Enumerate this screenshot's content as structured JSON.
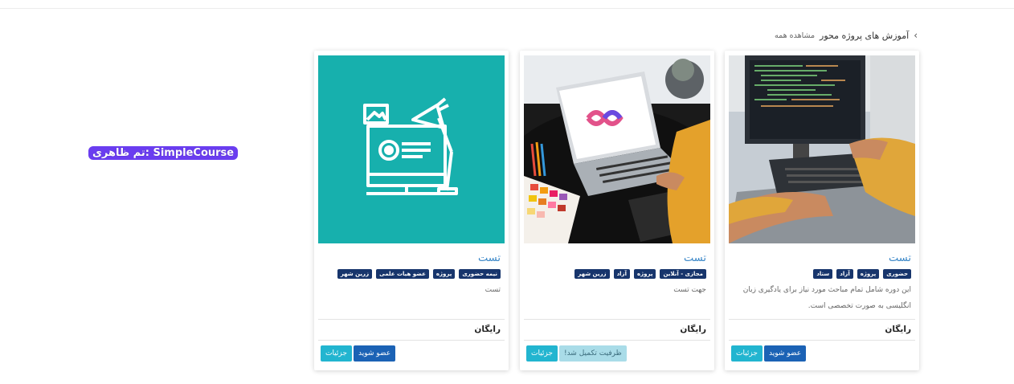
{
  "breadcrumb": {
    "title": "آموزش های پروژه محور",
    "subtitle": "مشاهده همه"
  },
  "theme_label": "SimpleCourse :تم ظاهری",
  "icons": {
    "breadcrumb": "chevron-right-icon"
  },
  "colors": {
    "title": "#3a87c8",
    "tag": "#17356c",
    "join_button": "#1b62b5",
    "details_button": "#22b5d0",
    "full_button": "#a9dce8",
    "placeholder_bg": "#17b0ad"
  },
  "cards": [
    {
      "title": "تست",
      "tags": [
        "حضوری",
        "پروژه",
        "آزاد",
        "ستاد"
      ],
      "description": "این دوره شامل تمام مباحث مورد نیاز برای یادگیری زبان انگلیسی به صورت تخصصی است.",
      "price": "رایگان",
      "primary_button": "عضو شوید",
      "details_button": "جزئیات"
    },
    {
      "title": "تست",
      "tags": [
        "مجازی - آنلاین",
        "پروژه",
        "آزاد",
        "زرین شهر"
      ],
      "description": "جهت تست",
      "price": "رایگان",
      "primary_button": "ظرفیت تکمیل شد!",
      "details_button": "جزئیات"
    },
    {
      "title": "تست",
      "tags": [
        "نیمه حضوری",
        "پروژه",
        "عضو هیات علمی",
        "زرین شهر"
      ],
      "description": "تست",
      "price": "رایگان",
      "primary_button": "عضو شوید",
      "details_button": "جزئیات"
    }
  ]
}
